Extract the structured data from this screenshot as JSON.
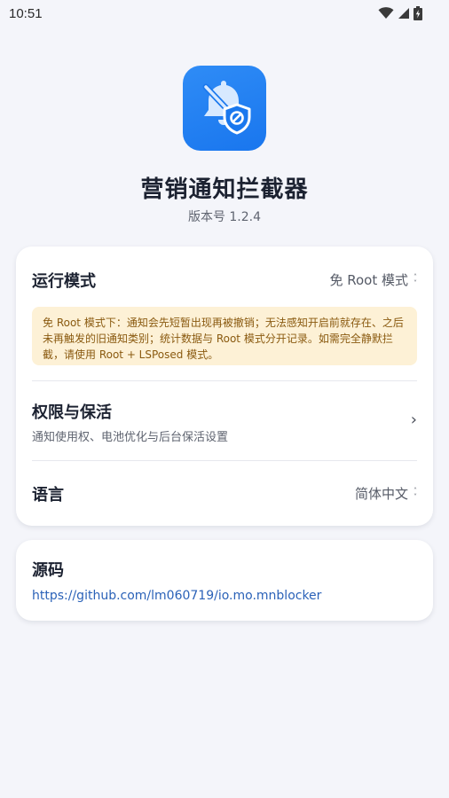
{
  "status_bar": {
    "time": "10:51"
  },
  "app": {
    "name": "营销通知拦截器",
    "version": "版本号 1.2.4",
    "accent": "#1976ee"
  },
  "settings": {
    "run_mode": {
      "label": "运行模式",
      "value": "免 Root 模式",
      "notice": "免 Root 模式下：通知会先短暂出现再被撤销；无法感知开启前就存在、之后未再触发的旧通知类别；统计数据与 Root 模式分开记录。如需完全静默拦截，请使用 Root + LSPosed 模式。"
    },
    "permissions": {
      "label": "权限与保活",
      "subtitle": "通知使用权、电池优化与后台保活设置"
    },
    "language": {
      "label": "语言",
      "value": "简体中文"
    }
  },
  "source": {
    "label": "源码",
    "url": "https://github.com/lm060719/io.mo.mnblocker"
  }
}
